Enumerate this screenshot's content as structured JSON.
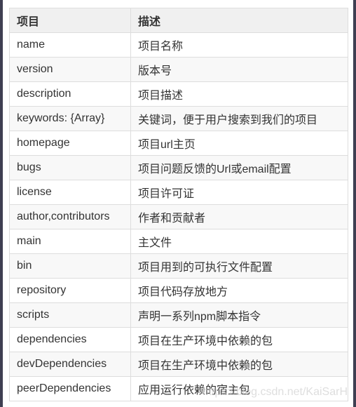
{
  "table": {
    "headers": [
      "项目",
      "描述"
    ],
    "rows": [
      {
        "key": "name",
        "desc": "项目名称"
      },
      {
        "key": "version",
        "desc": "版本号"
      },
      {
        "key": "description",
        "desc": "项目描述"
      },
      {
        "key": "keywords: {Array}",
        "desc": "关键词，便于用户搜索到我们的项目"
      },
      {
        "key": "homepage",
        "desc": "项目url主页"
      },
      {
        "key": "bugs",
        "desc": "项目问题反馈的Url或email配置"
      },
      {
        "key": "license",
        "desc": "项目许可证"
      },
      {
        "key": "author,contributors",
        "desc": "作者和贡献者"
      },
      {
        "key": "main",
        "desc": "主文件"
      },
      {
        "key": "bin",
        "desc": "项目用到的可执行文件配置"
      },
      {
        "key": "repository",
        "desc": "项目代码存放地方"
      },
      {
        "key": "scripts",
        "desc": "声明一系列npm脚本指令"
      },
      {
        "key": "dependencies",
        "desc": "项目在生产环境中依赖的包"
      },
      {
        "key": "devDependencies",
        "desc": "项目在生产环境中依赖的包"
      },
      {
        "key": "peerDependencies",
        "desc": "应用运行依赖的宿主包"
      }
    ]
  },
  "watermark": "https://blog.csdn.net/KaiSarH",
  "colors": {
    "frame": "#3f3f52",
    "header_bg": "#f0f0f0",
    "stripe_bg": "#f8f8f8",
    "border": "#dddddd",
    "text": "#333333"
  }
}
